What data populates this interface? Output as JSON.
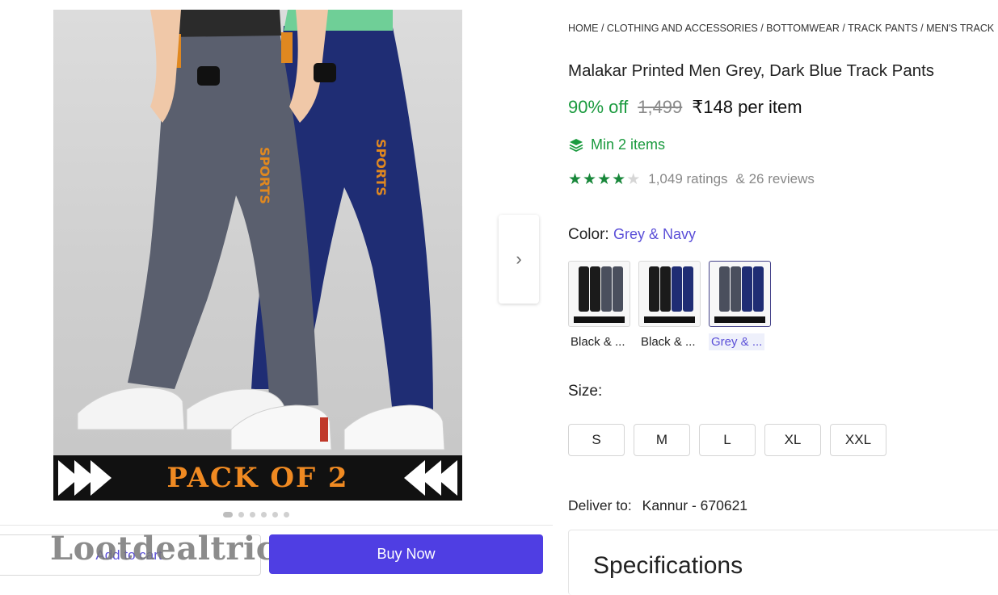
{
  "product": {
    "breadcrumb": "HOME / CLOTHING AND ACCESSORIES / BOTTOMWEAR / TRACK PANTS / MEN'S TRACK",
    "title": "Malakar Printed Men Grey, Dark Blue Track Pants",
    "discount": "90% off",
    "mrp": "1,499",
    "price": "₹148 per item",
    "min_items": "Min 2 items",
    "rating": {
      "stars": 4,
      "out_of": 5,
      "ratings_text": "1,049 ratings",
      "reviews_text": "& 26 reviews"
    },
    "color_label": "Color:",
    "color_value": "Grey & Navy",
    "color_options": [
      {
        "label": "Black & ...",
        "selected": false
      },
      {
        "label": "Black & ...",
        "selected": false
      },
      {
        "label": "Grey & ...",
        "selected": true
      }
    ],
    "size_label": "Size:",
    "sizes": [
      "S",
      "M",
      "L",
      "XL",
      "XXL"
    ],
    "deliver_label": "Deliver to:",
    "deliver_location": "Kannur - 670621",
    "specifications_title": "Specifications"
  },
  "gallery": {
    "banner_text": "PACK OF 2",
    "print_text": "SPORTS",
    "dots": 6,
    "active_dot": 0,
    "next_icon": "chevron-right-icon"
  },
  "actions": {
    "add_to_cart": "Add to cart",
    "buy_now": "Buy Now"
  },
  "watermark": "Lootdealtricky",
  "colors": {
    "accent": "#4f3ee3",
    "green": "#1a9a3e",
    "orange_print": "#f08a22"
  }
}
